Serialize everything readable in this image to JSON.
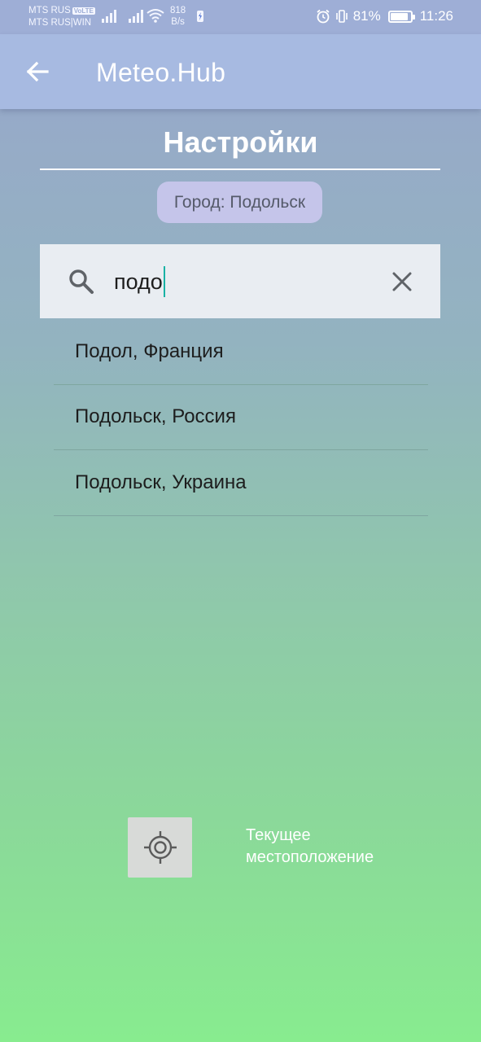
{
  "status_bar": {
    "carrier_line1": "MTS RUS",
    "volte": "VoLTE",
    "carrier_line2": "MTS RUS|WIN",
    "speed_value": "818",
    "speed_unit": "B/s",
    "battery_percent": "81%",
    "battery_level": 0.81,
    "time": "11:26",
    "icons": [
      "signal-icon",
      "signal-icon",
      "wifi-icon",
      "data-icon",
      "alarm-icon",
      "vibrate-icon",
      "battery-icon"
    ]
  },
  "app_bar": {
    "title": "Meteo.Hub",
    "back_icon": "arrow-left-icon"
  },
  "settings": {
    "title": "Настройки",
    "city_chip": "Город: Подольск"
  },
  "search": {
    "value": "подо",
    "search_icon": "search-icon",
    "clear_icon": "close-icon"
  },
  "results": [
    {
      "label": "Подол, Франция"
    },
    {
      "label": "Подольск, Россия"
    },
    {
      "label": "Подольск, Украина"
    }
  ],
  "location": {
    "icon": "gps-target-icon",
    "label_line1": "Текущее",
    "label_line2": "местоположение"
  },
  "colors": {
    "status_bar": "#9eaed6",
    "app_bar": "#a7bae1",
    "chip": "#c5c5ea",
    "search_box": "#e9edf2",
    "caret": "#19b2a5"
  }
}
